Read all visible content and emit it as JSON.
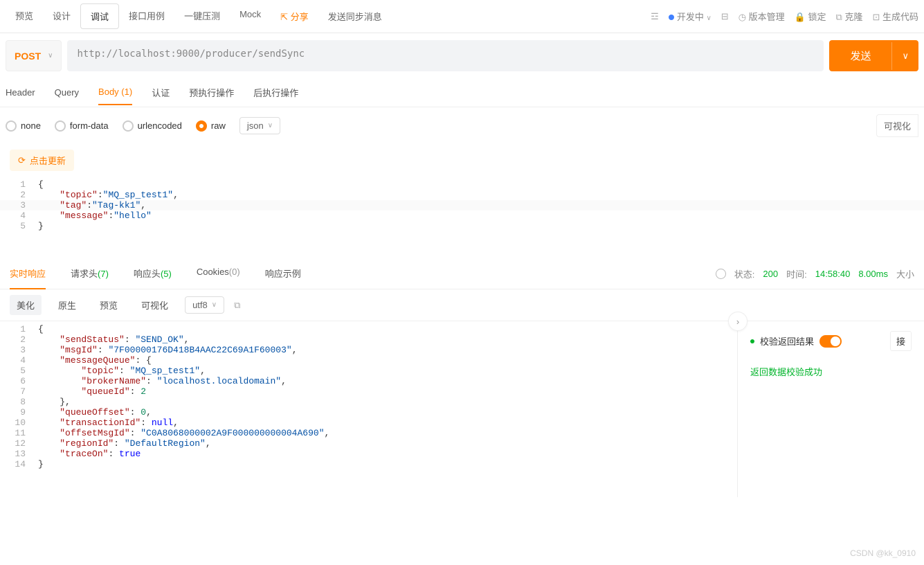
{
  "topTabs": [
    "预览",
    "设计",
    "调试",
    "接口用例",
    "一键压测",
    "Mock"
  ],
  "topTabActiveIndex": 2,
  "shareLabel": "分享",
  "apiTitle": "发送同步消息",
  "devStatus": "开发中",
  "topRight": {
    "version": "版本管理",
    "lock": "锁定",
    "clone": "克隆",
    "gen": "生成代码"
  },
  "method": "POST",
  "url": "http://localhost:9000/producer/sendSync",
  "sendLabel": "发送",
  "subTabs": [
    {
      "label": "Header",
      "count": null
    },
    {
      "label": "Query",
      "count": null
    },
    {
      "label": "Body",
      "count": "(1)",
      "active": true
    },
    {
      "label": "认证",
      "count": null
    },
    {
      "label": "预执行操作",
      "count": null
    },
    {
      "label": "后执行操作",
      "count": null
    }
  ],
  "bodyFormats": [
    "none",
    "form-data",
    "urlencoded",
    "raw"
  ],
  "bodyFormatSelected": "raw",
  "rawType": "json",
  "visualizeLabel": "可视化",
  "refreshLabel": "点击更新",
  "requestBody": {
    "lines": [
      {
        "n": 1,
        "html": "<span class='brace'>{</span>"
      },
      {
        "n": 2,
        "html": "    <span class='key'>\"topic\"</span><span class='punct'>:</span><span class='str'>\"MQ_sp_test1\"</span><span class='punct'>,</span>"
      },
      {
        "n": 3,
        "html": "    <span class='key'>\"tag\"</span><span class='punct'>:</span><span class='str'>\"Tag-kk1\"</span><span class='punct'>,</span>",
        "hl": true
      },
      {
        "n": 4,
        "html": "    <span class='key'>\"message\"</span><span class='punct'>:</span><span class='str'>\"hello\"</span>"
      },
      {
        "n": 5,
        "html": "<span class='brace'>}</span>"
      }
    ],
    "data": {
      "topic": "MQ_sp_test1",
      "tag": "Tag-kk1",
      "message": "hello"
    }
  },
  "respTabs": [
    {
      "label": "实时响应",
      "active": true
    },
    {
      "label": "请求头",
      "count": "(7)",
      "countClass": "cnt-g"
    },
    {
      "label": "响应头",
      "count": "(5)",
      "countClass": "cnt-g"
    },
    {
      "label": "Cookies",
      "count": "(0)",
      "countClass": "cnt-gr"
    },
    {
      "label": "响应示例"
    }
  ],
  "respMeta": {
    "statusLabel": "状态:",
    "status": "200",
    "timeLabel": "时间:",
    "time": "14:58:40",
    "duration": "8.00ms",
    "sizeLabel": "大小"
  },
  "respToolbar": {
    "pretty": "美化",
    "raw": "原生",
    "preview": "预览",
    "visual": "可视化",
    "charset": "utf8"
  },
  "checkLabel": "校验返回结果",
  "extraBtn": "接",
  "successMsg": "返回数据校验成功",
  "responseBody": {
    "lines": [
      {
        "n": 1,
        "html": "<span class='brace'>{</span>"
      },
      {
        "n": 2,
        "html": "    <span class='key'>\"sendStatus\"</span><span class='punct'>: </span><span class='str'>\"SEND_OK\"</span><span class='punct'>,</span>"
      },
      {
        "n": 3,
        "html": "    <span class='key'>\"msgId\"</span><span class='punct'>: </span><span class='str'>\"7F00000176D418B4AAC22C69A1F60003\"</span><span class='punct'>,</span>"
      },
      {
        "n": 4,
        "html": "    <span class='key'>\"messageQueue\"</span><span class='punct'>: </span><span class='brace'>{</span>"
      },
      {
        "n": 5,
        "html": "        <span class='key'>\"topic\"</span><span class='punct'>: </span><span class='str'>\"MQ_sp_test1\"</span><span class='punct'>,</span>"
      },
      {
        "n": 6,
        "html": "        <span class='key'>\"brokerName\"</span><span class='punct'>: </span><span class='str'>\"localhost.localdomain\"</span><span class='punct'>,</span>"
      },
      {
        "n": 7,
        "html": "        <span class='key'>\"queueId\"</span><span class='punct'>: </span><span class='num'>2</span>"
      },
      {
        "n": 8,
        "html": "    <span class='brace'>}</span><span class='punct'>,</span>"
      },
      {
        "n": 9,
        "html": "    <span class='key'>\"queueOffset\"</span><span class='punct'>: </span><span class='num'>0</span><span class='punct'>,</span>"
      },
      {
        "n": 10,
        "html": "    <span class='key'>\"transactionId\"</span><span class='punct'>: </span><span class='kw'>null</span><span class='punct'>,</span>"
      },
      {
        "n": 11,
        "html": "    <span class='key'>\"offsetMsgId\"</span><span class='punct'>: </span><span class='str'>\"C0A8068000002A9F000000000004A690\"</span><span class='punct'>,</span>"
      },
      {
        "n": 12,
        "html": "    <span class='key'>\"regionId\"</span><span class='punct'>: </span><span class='str'>\"DefaultRegion\"</span><span class='punct'>,</span>"
      },
      {
        "n": 13,
        "html": "    <span class='key'>\"traceOn\"</span><span class='punct'>: </span><span class='kw'>true</span>"
      },
      {
        "n": 14,
        "html": "<span class='brace'>}</span>"
      }
    ],
    "data": {
      "sendStatus": "SEND_OK",
      "msgId": "7F00000176D418B4AAC22C69A1F60003",
      "messageQueue": {
        "topic": "MQ_sp_test1",
        "brokerName": "localhost.localdomain",
        "queueId": 2
      },
      "queueOffset": 0,
      "transactionId": null,
      "offsetMsgId": "C0A8068000002A9F000000000004A690",
      "regionId": "DefaultRegion",
      "traceOn": true
    }
  },
  "watermark": "CSDN @kk_0910"
}
